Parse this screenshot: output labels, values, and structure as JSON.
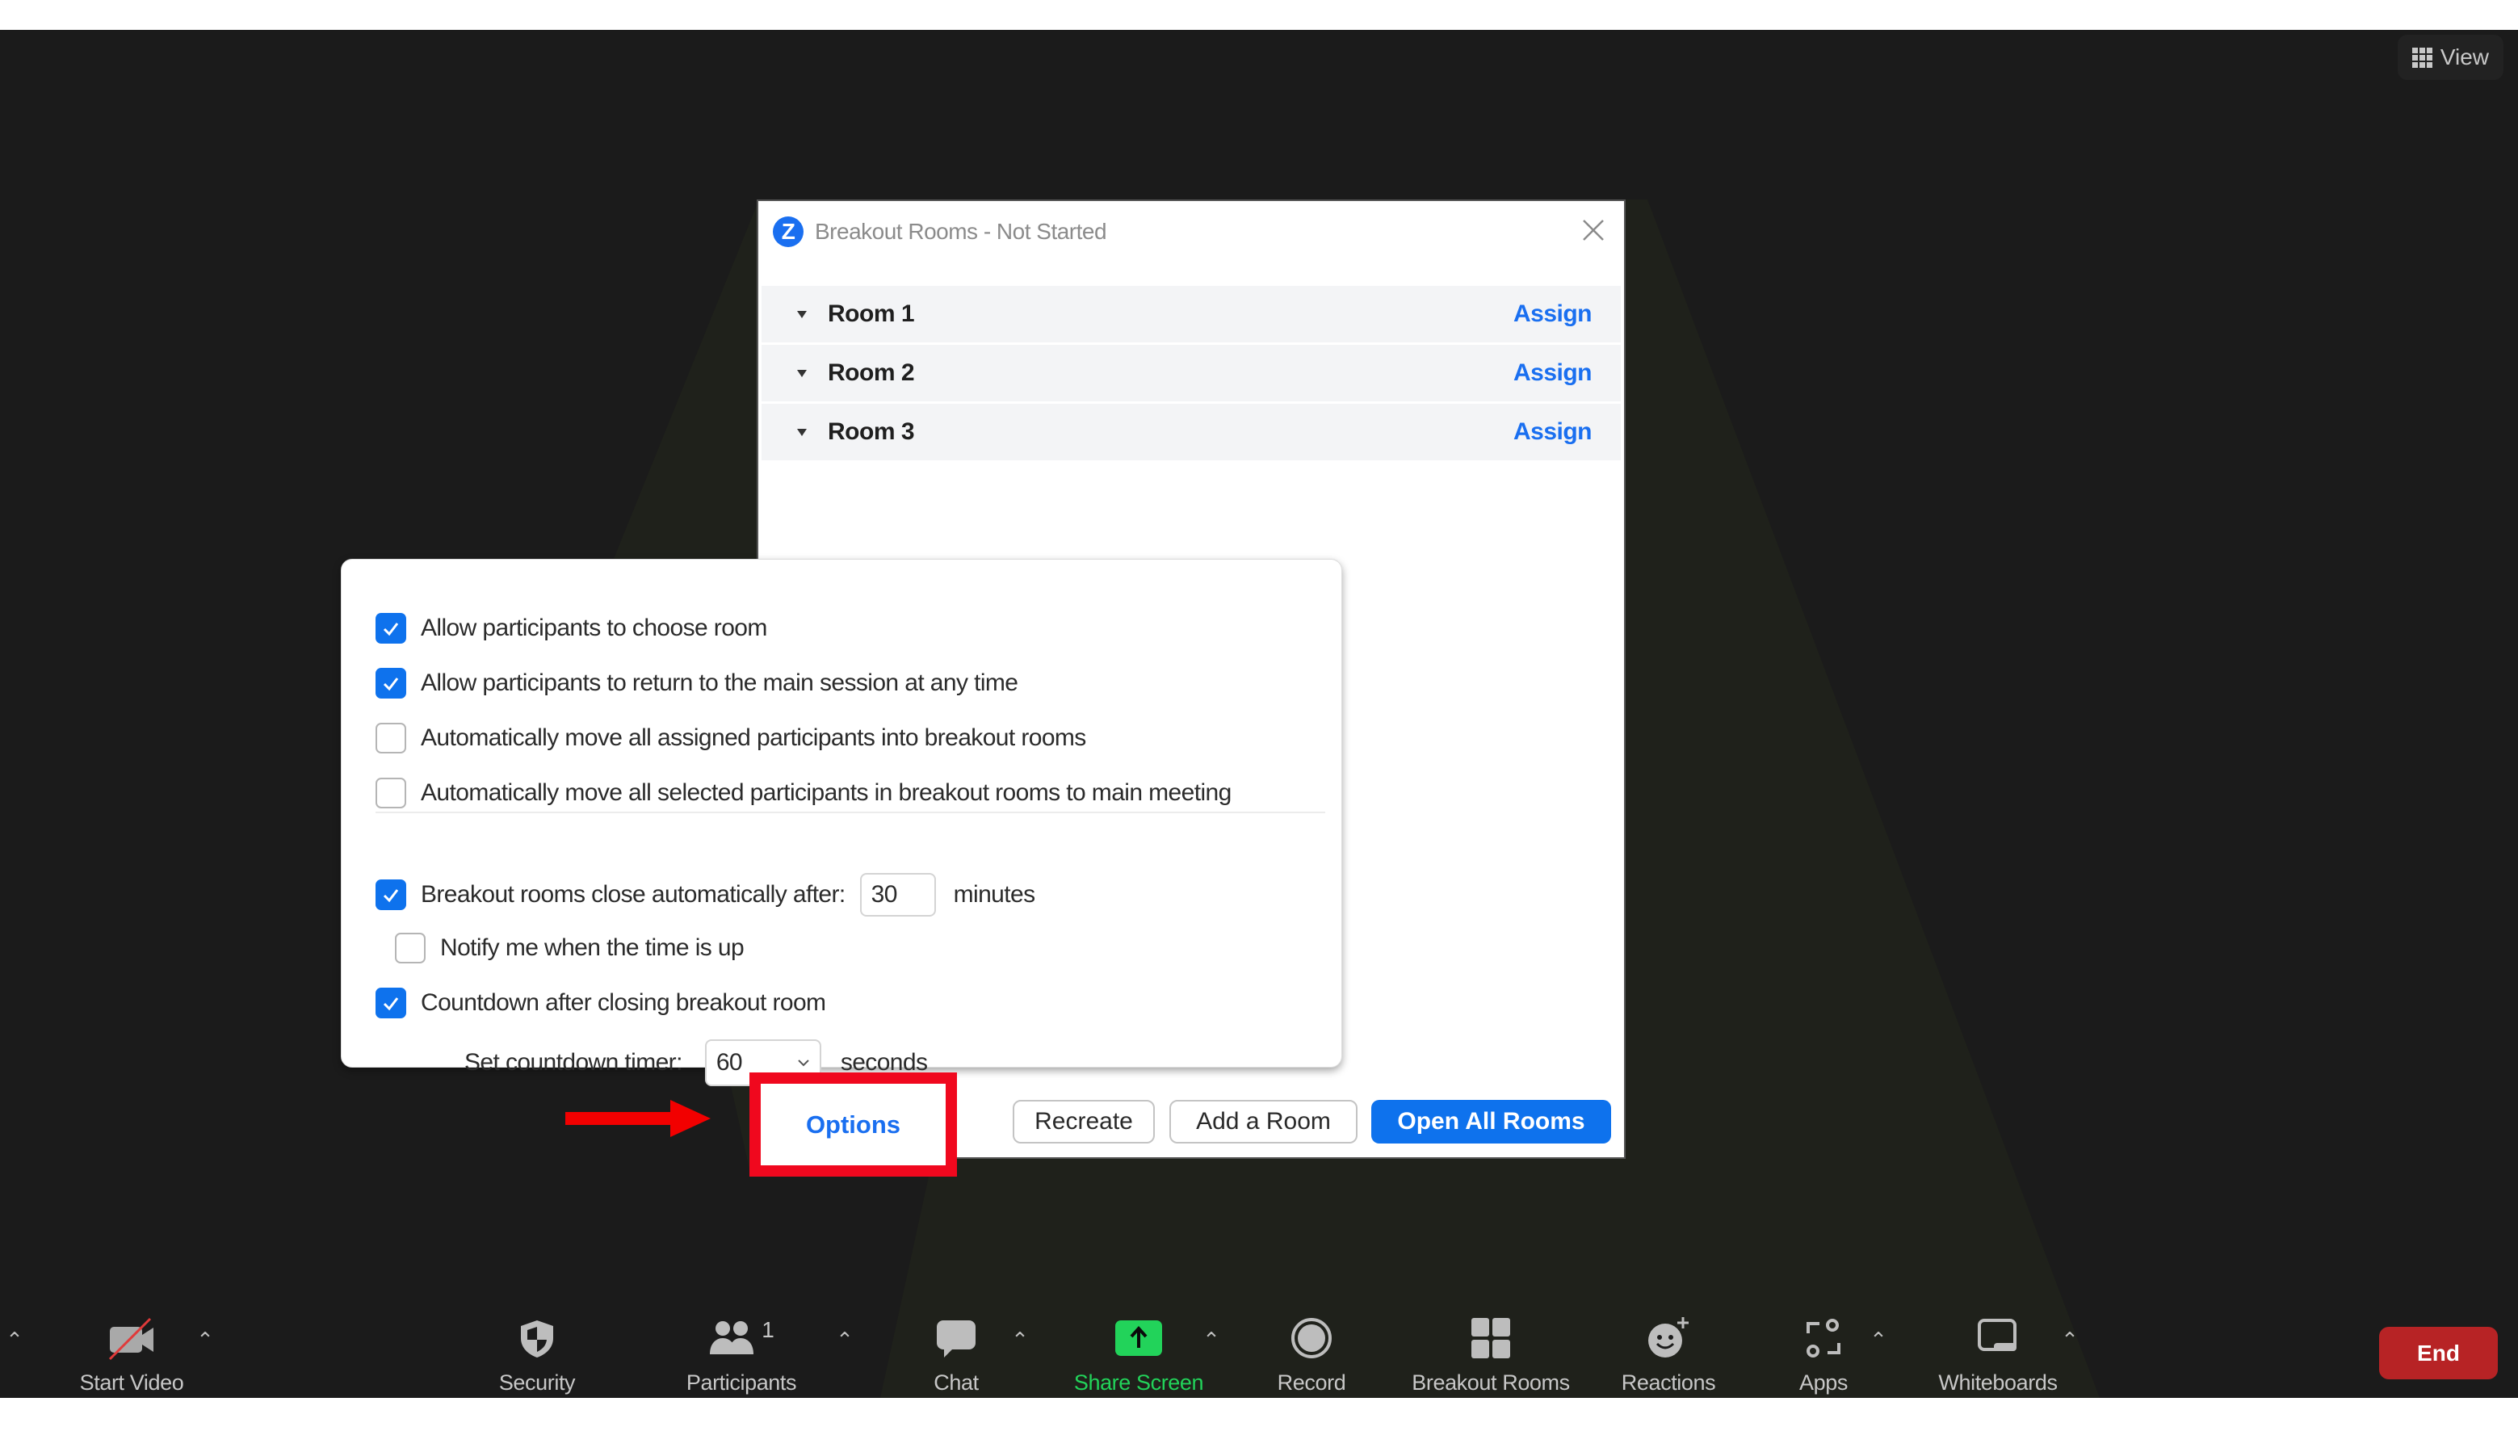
{
  "view_button": {
    "label": "View",
    "icon": "grid-icon"
  },
  "dialog": {
    "title": "Breakout Rooms - Not Started",
    "logo_letter": "Z",
    "rooms": [
      {
        "name": "Room 1",
        "action": "Assign"
      },
      {
        "name": "Room 2",
        "action": "Assign"
      },
      {
        "name": "Room 3",
        "action": "Assign"
      }
    ],
    "footer": {
      "options": "Options",
      "recreate": "Recreate",
      "add_room": "Add a Room",
      "open_all": "Open All Rooms"
    }
  },
  "options_panel": {
    "items": [
      {
        "label": "Allow participants to choose room",
        "checked": true
      },
      {
        "label": "Allow participants to return to the main session at any time",
        "checked": true
      },
      {
        "label": "Automatically move all assigned participants into breakout rooms",
        "checked": false
      },
      {
        "label": "Automatically move all selected participants in breakout rooms to main meeting",
        "checked": false
      }
    ],
    "auto_close": {
      "label": "Breakout rooms close automatically after:",
      "checked": true,
      "value": "30",
      "unit": "minutes"
    },
    "notify": {
      "label": "Notify me when the time is up",
      "checked": false
    },
    "countdown": {
      "label": "Countdown after closing breakout room",
      "checked": true
    },
    "countdown_timer": {
      "label": "Set countdown timer:",
      "value": "60",
      "unit": "seconds"
    }
  },
  "toolbar": {
    "items": [
      {
        "id": "start-video",
        "label": "Start Video",
        "icon": "video-off-icon"
      },
      {
        "id": "security",
        "label": "Security",
        "icon": "shield-icon"
      },
      {
        "id": "participants",
        "label": "Participants",
        "icon": "participants-icon",
        "count": "1"
      },
      {
        "id": "chat",
        "label": "Chat",
        "icon": "chat-icon"
      },
      {
        "id": "share-screen",
        "label": "Share Screen",
        "icon": "share-screen-icon"
      },
      {
        "id": "record",
        "label": "Record",
        "icon": "record-icon"
      },
      {
        "id": "breakout-rooms",
        "label": "Breakout Rooms",
        "icon": "breakout-rooms-icon"
      },
      {
        "id": "reactions",
        "label": "Reactions",
        "icon": "reactions-icon"
      },
      {
        "id": "apps",
        "label": "Apps",
        "icon": "apps-icon"
      },
      {
        "id": "whiteboards",
        "label": "Whiteboards",
        "icon": "whiteboards-icon"
      }
    ],
    "end_label": "End"
  },
  "colors": {
    "accent_blue": "#0e72ed",
    "share_green": "#22d35a",
    "end_red": "#b72325",
    "highlight_red": "#f0081e"
  }
}
